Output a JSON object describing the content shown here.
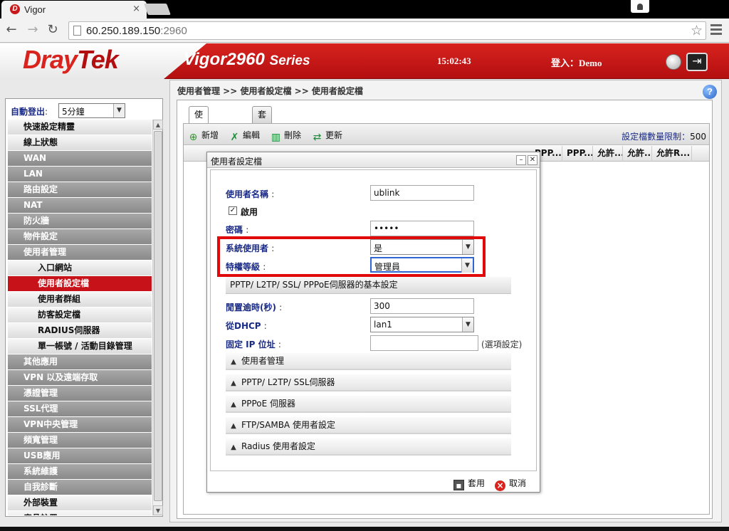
{
  "browser": {
    "tab_title": "Vigor",
    "tab_favicon": "D",
    "tab_close": "×",
    "url_host": "60.250.189.150",
    "url_port": ":2960"
  },
  "header": {
    "logo_dray": "Dray",
    "logo_tek": "Tek",
    "model": "Vigor2960",
    "series": "Series",
    "time": "15:02:43",
    "login": "登入：Demo"
  },
  "sidebar": {
    "autologout_label": "自動登出",
    "autologout_colon": ":",
    "autologout_value": "5分鐘",
    "items": [
      {
        "label": "快速設定精靈",
        "style": "light"
      },
      {
        "label": "線上狀態",
        "style": "light"
      },
      {
        "label": "WAN",
        "style": "dark"
      },
      {
        "label": "LAN",
        "style": "dark"
      },
      {
        "label": "路由設定",
        "style": "dark"
      },
      {
        "label": "NAT",
        "style": "dark"
      },
      {
        "label": "防火牆",
        "style": "dark"
      },
      {
        "label": "物件設定",
        "style": "dark"
      },
      {
        "label": "使用者管理",
        "style": "dark"
      },
      {
        "label": "入口網站",
        "style": "sub"
      },
      {
        "label": "使用者設定檔",
        "style": "sub active"
      },
      {
        "label": "使用者群組",
        "style": "sub"
      },
      {
        "label": "訪客設定檔",
        "style": "sub"
      },
      {
        "label": "RADIUS伺服器",
        "style": "sub"
      },
      {
        "label": "單一帳號 / 活動目錄管理",
        "style": "sub"
      },
      {
        "label": "其他應用",
        "style": "dark"
      },
      {
        "label": "VPN 以及遠端存取",
        "style": "dark"
      },
      {
        "label": "憑證管理",
        "style": "dark"
      },
      {
        "label": "SSL代理",
        "style": "dark"
      },
      {
        "label": "VPN中央管理",
        "style": "dark"
      },
      {
        "label": "頻寬管理",
        "style": "dark"
      },
      {
        "label": "USB應用",
        "style": "dark"
      },
      {
        "label": "系統維護",
        "style": "dark"
      },
      {
        "label": "自我診斷",
        "style": "dark"
      },
      {
        "label": "外部裝置",
        "style": "light"
      },
      {
        "label": "產品註冊",
        "style": "light"
      }
    ]
  },
  "main": {
    "breadcrumb": "使用者管理 >> 使用者設定檔 >> 使用者設定檔",
    "tabs": [
      "使用者設定檔",
      "套用全部"
    ],
    "toolbar": {
      "add": "新增",
      "edit": "編輯",
      "delete": "刪除",
      "refresh": "更新",
      "limit_label": "設定檔數量限制：",
      "limit_value": "500"
    },
    "columns": [
      "PPP...",
      "PPP...",
      "允許...",
      "允許...",
      "允許R..."
    ]
  },
  "dialog": {
    "title": "使用者設定檔",
    "username_label": "使用者名稱",
    "username_value": "ublink",
    "enable_label": "啟用",
    "enable_checked": "✓",
    "password_label": "密碼",
    "password_value": "•••••",
    "system_user_label": "系統使用者",
    "system_user_value": "是",
    "privilege_label": "特權等級",
    "privilege_value": "管理員",
    "basic_section": "PPTP/ L2TP/ SSL/ PPPoE伺服器的基本設定",
    "idle_label": "閒置逾時(秒)",
    "idle_value": "300",
    "dhcp_label": "從DHCP",
    "dhcp_value": "lan1",
    "fixed_ip_label": "固定 IP 位址",
    "fixed_ip_value": "",
    "optional": "(選項設定)",
    "colon": ":",
    "sections": [
      "使用者管理",
      "PPTP/ L2TP/ SSL伺服器",
      "PPPoE 伺服器",
      "FTP/SAMBA 使用者設定",
      "Radius 使用者設定"
    ],
    "apply": "套用",
    "cancel": "取消"
  }
}
